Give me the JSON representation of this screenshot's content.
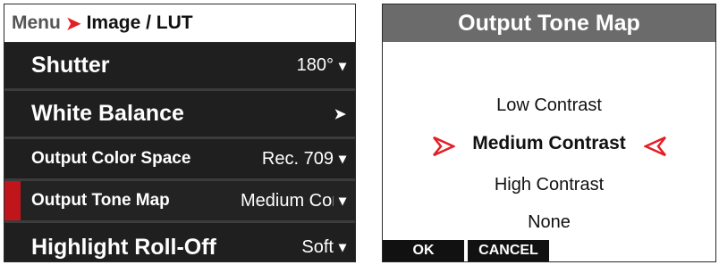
{
  "menu": {
    "breadcrumb_root": "Menu",
    "breadcrumb_sep": "➤",
    "breadcrumb_current": "Image / LUT",
    "items": [
      {
        "label": "Shutter",
        "value": "180°",
        "control": "chevron-down"
      },
      {
        "label": "White Balance",
        "value": "",
        "control": "arrow-right"
      },
      {
        "label": "Output Color Space",
        "value": "Rec. 709",
        "control": "chevron-down"
      },
      {
        "label": "Output Tone Map",
        "value": "Medium Contrast",
        "control": "chevron-down",
        "selected": true
      },
      {
        "label": "Highlight Roll-Off",
        "value": "Soft",
        "control": "chevron-down"
      }
    ]
  },
  "dialog": {
    "title": "Output Tone Map",
    "options": [
      "Low Contrast",
      "Medium Contrast",
      "High Contrast",
      "None"
    ],
    "selected_option": "Medium Contrast",
    "ok_label": "OK",
    "cancel_label": "CANCEL"
  },
  "colors": {
    "accent_red": "#e41e26",
    "selection_bar": "#c0151b",
    "menu_bg": "#1f1f1f",
    "dialog_title_bg": "#6b6b6b"
  }
}
